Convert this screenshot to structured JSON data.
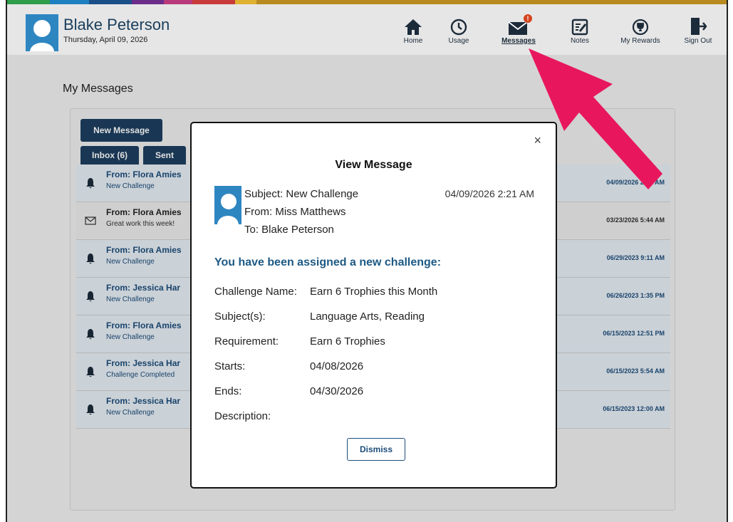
{
  "colors": {
    "accent": "#1d3f60",
    "arrow": "#e8175d",
    "badge": "#d4431e"
  },
  "header": {
    "user_name": "Blake Peterson",
    "date": "Thursday, April 09, 2026"
  },
  "nav": {
    "home": {
      "label": "Home",
      "icon": "home-icon"
    },
    "usage": {
      "label": "Usage",
      "icon": "clock-icon"
    },
    "messages": {
      "label": "Messages",
      "icon": "envelope-icon",
      "badge": "!"
    },
    "notes": {
      "label": "Notes",
      "icon": "notes-icon"
    },
    "rewards": {
      "label": "My Rewards",
      "icon": "trophy-icon"
    },
    "signout": {
      "label": "Sign Out",
      "icon": "sign-out-icon"
    }
  },
  "page": {
    "title": "My Messages",
    "new_message_label": "New Message",
    "tabs": [
      "Inbox (6)",
      "Sent"
    ]
  },
  "messages": [
    {
      "from": "From: Flora Amies",
      "subject": "New Challenge",
      "date": "04/09/2026 2:21 AM",
      "icon": "bell-icon"
    },
    {
      "from": "From: Flora Amies",
      "subject": "Great work this week!",
      "date": "03/23/2026 5:44 AM",
      "icon": "envelope-outline-icon"
    },
    {
      "from": "From: Flora Amies",
      "subject": "New Challenge",
      "date": "06/29/2023 9:11 AM",
      "icon": "bell-icon"
    },
    {
      "from": "From: Jessica Har",
      "subject": "New Challenge",
      "date": "06/26/2023 1:35 PM",
      "icon": "bell-icon"
    },
    {
      "from": "From: Flora Amies",
      "subject": "New Challenge",
      "date": "06/15/2023 12:51 PM",
      "icon": "bell-icon"
    },
    {
      "from": "From: Jessica Har",
      "subject": "Challenge Completed",
      "date": "06/15/2023 5:54 AM",
      "icon": "bell-icon"
    },
    {
      "from": "From: Jessica Har",
      "subject": "New Challenge",
      "date": "06/15/2023 12:00 AM",
      "icon": "bell-icon"
    }
  ],
  "modal": {
    "title": "View Message",
    "close": "×",
    "subject": "Subject: New Challenge",
    "from": "From: Miss Matthews",
    "to": "To: Blake Peterson",
    "datetime": "04/09/2026 2:21 AM",
    "heading": "You have been assigned a new challenge:",
    "fields": [
      {
        "key": "Challenge Name:",
        "value": "Earn 6 Trophies this Month"
      },
      {
        "key": "Subject(s):",
        "value": "Language Arts, Reading"
      },
      {
        "key": "Requirement:",
        "value": "Earn 6 Trophies"
      },
      {
        "key": "Starts:",
        "value": "04/08/2026"
      },
      {
        "key": "Ends:",
        "value": "04/30/2026"
      },
      {
        "key": "Description:",
        "value": ""
      }
    ],
    "dismiss_label": "Dismiss"
  }
}
